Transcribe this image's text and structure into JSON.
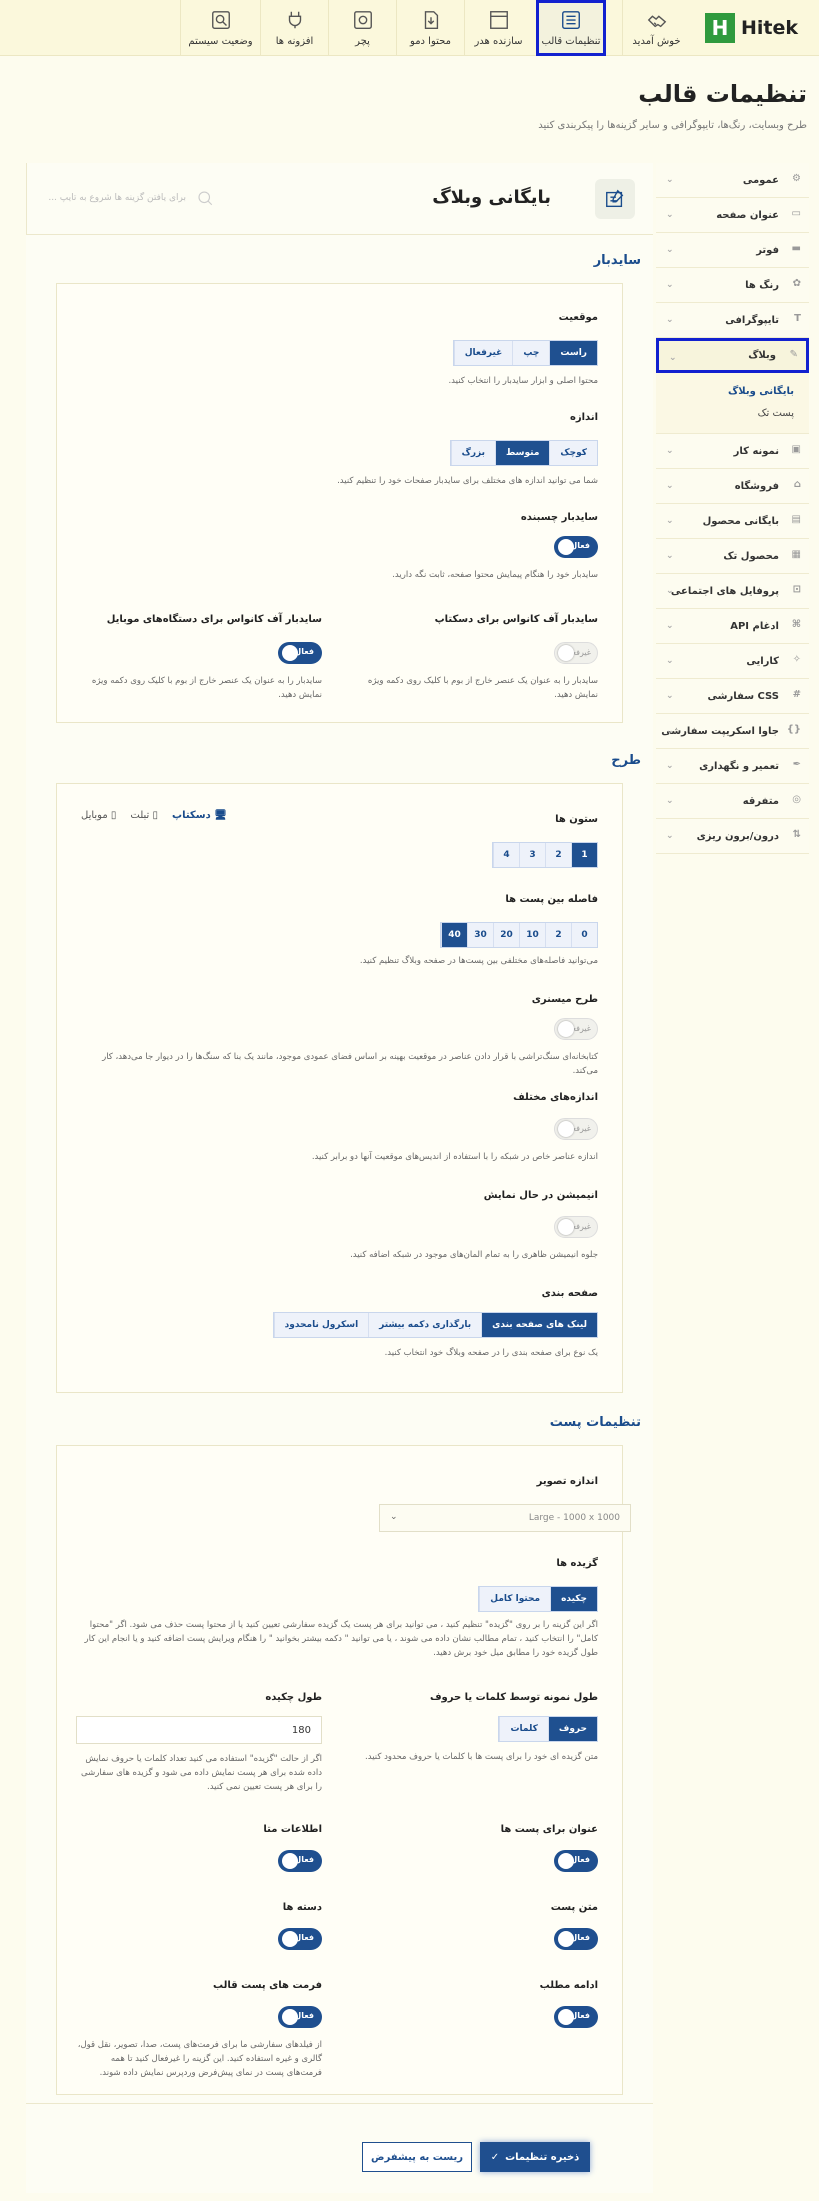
{
  "brand": {
    "name": "Hitek",
    "mark": "H",
    "color": "#2f9a3e"
  },
  "topnav": [
    {
      "label": "خوش آمدید",
      "icon": "handshake-icon"
    },
    {
      "label": "تنظیمات قالب",
      "icon": "settings-list-icon",
      "active": true
    },
    {
      "label": "سازنده هدر",
      "icon": "header-builder-icon"
    },
    {
      "label": "محتوا دمو",
      "icon": "import-icon"
    },
    {
      "label": "پچر",
      "icon": "patcher-icon"
    },
    {
      "label": "افزونه ها",
      "icon": "plugins-icon"
    },
    {
      "label": "وضعیت سیستم",
      "icon": "system-status-icon"
    }
  ],
  "page": {
    "title": "تنظیمات قالب",
    "description": "طرح وبسایت، رنگ‌ها، تایپوگرافی و سایر گزینه‌ها را پیکربندی کنید"
  },
  "search": {
    "placeholder": "برای یافتن گزینه ها شروع به تایپ ..."
  },
  "sidebar": {
    "items": [
      {
        "label": "عمومی",
        "icon": "gear-icon"
      },
      {
        "label": "عنوان صفحه",
        "icon": "page-title-icon"
      },
      {
        "label": "فوتر",
        "icon": "footer-icon"
      },
      {
        "label": "رنگ ها",
        "icon": "palette-icon"
      },
      {
        "label": "تایپوگرافی",
        "icon": "typography-icon"
      },
      {
        "label": "وبلاگ",
        "icon": "blog-icon",
        "active": true
      },
      {
        "label": "نمونه کار",
        "icon": "portfolio-icon"
      },
      {
        "label": "فروشگاه",
        "icon": "shop-icon"
      },
      {
        "label": "بایگانی محصول",
        "icon": "product-archive-icon"
      },
      {
        "label": "محصول تک",
        "icon": "single-product-icon"
      },
      {
        "label": "پروفایل های اجتماعی",
        "icon": "social-icon"
      },
      {
        "label": "ادغام API",
        "icon": "api-icon"
      },
      {
        "label": "کارایی",
        "icon": "performance-icon"
      },
      {
        "label": "CSS سفارشی",
        "icon": "css-icon"
      },
      {
        "label": "جاوا اسکریپت سفارشی",
        "icon": "js-icon"
      },
      {
        "label": "تعمیر و نگهداری",
        "icon": "maintenance-icon"
      },
      {
        "label": "متفرقه",
        "icon": "misc-icon"
      },
      {
        "label": "درون/برون ریزی",
        "icon": "import-export-icon"
      }
    ],
    "sub": [
      "بایگانی وبلاگ",
      "پست تک"
    ]
  },
  "main": {
    "title": "بایگانی وبلاگ"
  },
  "sidebar_section": {
    "title": "سایدبار",
    "position": {
      "label": "موقعیت",
      "options": [
        "راست",
        "چپ",
        "غیرفعال"
      ],
      "selected": 0,
      "help": "محتوا اصلی و ابزار سایدبار را انتخاب کنید."
    },
    "size": {
      "label": "اندازه",
      "options": [
        "کوچک",
        "متوسط",
        "بزرگ"
      ],
      "selected": 1,
      "help": "شما می توانید اندازه های مختلف برای سایدبار صفحات خود را تنظیم کنید."
    },
    "sticky": {
      "label": "سایدبار چسبنده",
      "state": "فعال",
      "help": "سایدبار خود را هنگام پیمایش محتوا صفحه، ثابت نگه دارید."
    },
    "offcanvas_desktop": {
      "label": "سایدبار آف کانواس برای دسکتاپ",
      "state": "غیرفعال",
      "help": "سایدبار را به عنوان یک عنصر خارج از بوم با کلیک روی دکمه ویژه نمایش دهید."
    },
    "offcanvas_mobile": {
      "label": "سایدبار آف کانواس برای دستگاه‌های موبایل",
      "state": "فعال",
      "help": "سایدبار را به عنوان یک عنصر خارج از بوم با کلیک روی دکمه ویژه نمایش دهید."
    }
  },
  "layout_section": {
    "title": "طرح",
    "devices": [
      "دسکتاپ",
      "تبلت",
      "موبایل"
    ],
    "columns": {
      "label": "ستون ها",
      "options": [
        "1",
        "2",
        "3",
        "4"
      ],
      "selected": 0
    },
    "spacing": {
      "label": "فاصله بین پست ها",
      "options": [
        "0",
        "2",
        "10",
        "20",
        "30",
        "40"
      ],
      "selected": 5,
      "help": "می‌توانید فاصله‌های مختلفی بین پست‌ها در صفحه وبلاگ تنظیم کنید."
    },
    "masonry": {
      "label": "طرح میسنری",
      "state": "غیرفعال",
      "help": "کتابخانه‌ای سنگ‌تراشی با قرار دادن عناصر در موقعیت بهینه بر اساس فضای عمودی موجود، مانند یک بنا که سنگ‌ها را در دیوار جا می‌دهد، کار می‌کند."
    },
    "different_sizes": {
      "label": "اندازه‌های مختلف",
      "state": "غیرفعال",
      "help": "اندازه عناصر خاص در شبکه را با استفاده از اندیس‌های موقعیت آنها دو برابر کنید."
    },
    "animation": {
      "label": "انیمیشن در حال نمایش",
      "state": "غیرفعال",
      "help": "جلوه انیمیشن ظاهری را به تمام المان‌های موجود در شبکه اضافه کنید."
    },
    "pagination": {
      "label": "صفحه بندی",
      "options": [
        "لینک های صفحه بندی",
        "بارگذاری دکمه بیشتر",
        "اسکرول نامحدود"
      ],
      "selected": 0,
      "help": "یک نوع برای صفحه بندی را در صفحه وبلاگ خود انتخاب کنید."
    }
  },
  "post_section": {
    "title": "تنظیمات پست",
    "image_size": {
      "label": "اندازه تصویر",
      "value": "Large - 1000 x 1000"
    },
    "excerpt": {
      "label": "گزیده ها",
      "options": [
        "چکیده",
        "محتوا کامل"
      ],
      "selected": 0,
      "help": "اگر این گزینه را بر روی \"گزیده\" تنظیم کنید ، می توانید برای هر پست یک گزیده سفارشی تعیین کنید یا از محتوا پست حذف می شود. اگر \"محتوا کامل\" را انتخاب کنید ، تمام مطالب نشان داده می شوند ، یا می توانید \" دکمه بیشتر بخوانید \" را هنگام ویرایش پست اضافه کنید و یا انجام این کار طول گزیده خود را مطابق میل خود برش دهید."
    },
    "excerpt_by": {
      "label": "طول نمونه توسط کلمات یا حروف",
      "options": [
        "حروف",
        "کلمات"
      ],
      "selected": 0,
      "help": "متن گزیده ای خود را برای پست ها با کلمات یا حروف محدود کنید."
    },
    "excerpt_length": {
      "label": "طول چکیده",
      "value": "180",
      "help": "اگر از حالت \"گزیده\" استفاده می کنید تعداد کلمات یا حروف نمایش داده شده برای هر پست نمایش داده می شود و گزیده های سفارشی را برای هر پست تعیین نمی کنید."
    },
    "post_title": {
      "label": "عنوان برای پست ها",
      "state": "فعال"
    },
    "meta": {
      "label": "اطلاعات متا",
      "state": "فعال"
    },
    "post_text": {
      "label": "متن پست",
      "state": "فعال"
    },
    "categories": {
      "label": "دسته ها",
      "state": "فعال"
    },
    "read_more": {
      "label": "ادامه مطلب",
      "state": "فعال"
    },
    "post_formats": {
      "label": "فرمت های پست قالب",
      "state": "فعال",
      "help": "از فیلدهای سفارشی ما برای فرمت‌های پست، صدا، تصویر، نقل قول، گالری و غیره استفاده کنید. این گزینه را غیرفعال کنید تا همه فرمت‌های پست در نمای پیش‌فرض وردپرس نمایش داده شوند."
    }
  },
  "footer": {
    "save": "ذخیره تنظیمات",
    "reset": "ریست به پیشفرض"
  },
  "colors": {
    "accent": "#1f4f8f",
    "highlight": "#1221cf",
    "background": "#fdfcee"
  }
}
